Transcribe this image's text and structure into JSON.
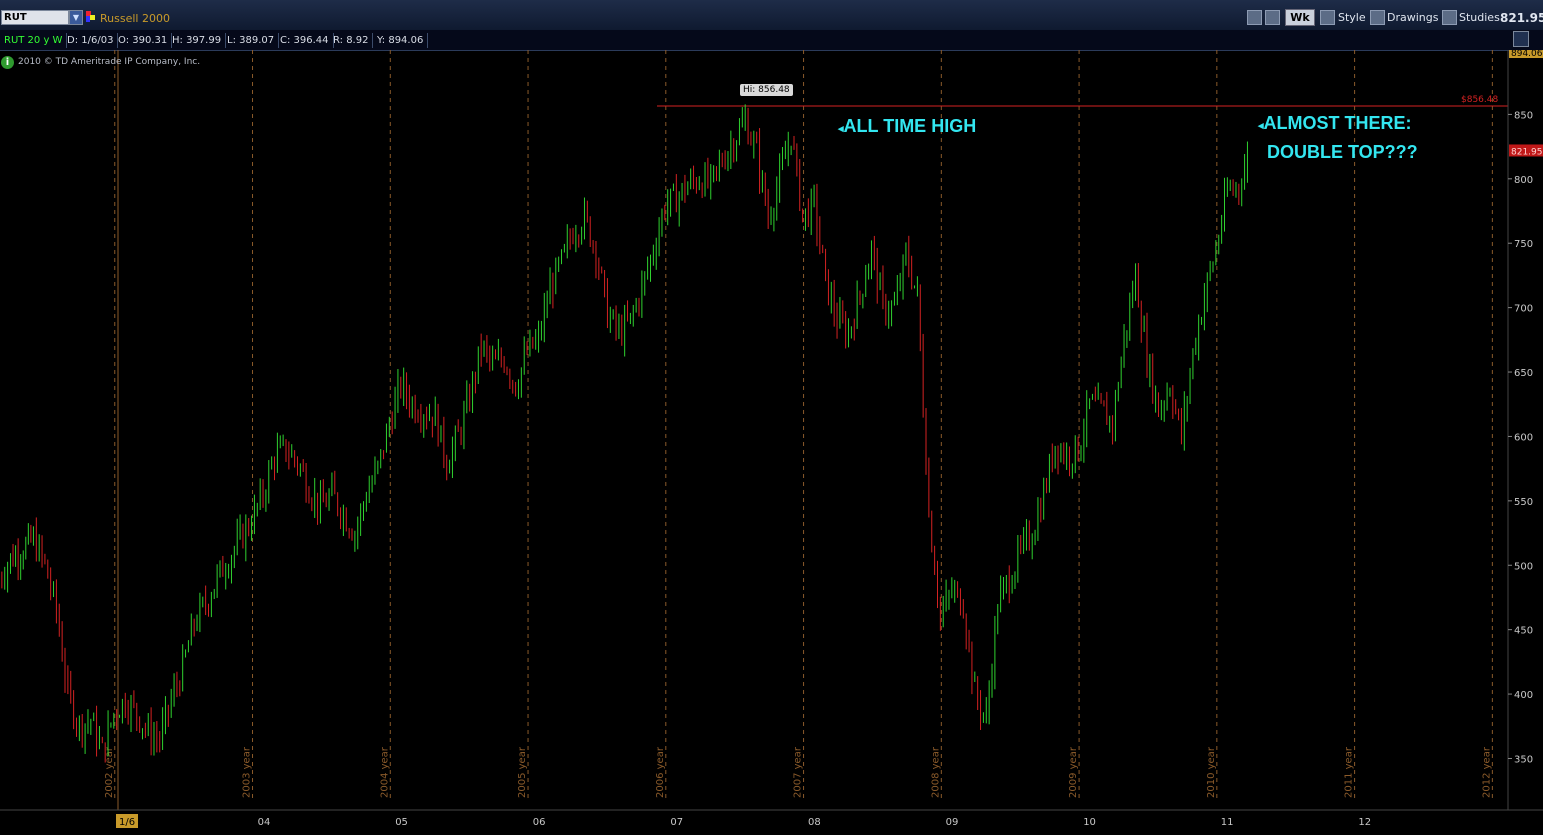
{
  "toolbar": {
    "symbol": "RUT",
    "symbol_name": "Russell 2000",
    "aggregation": "Wk",
    "style_label": "Style",
    "drawings_label": "Drawings",
    "studies_label": "Studies",
    "last_price": "821.95"
  },
  "infobar": {
    "study": "RUT 20 y W",
    "date": "D: 1/6/03",
    "open": "O: 390.31",
    "high": "H: 397.99",
    "low": "L: 389.07",
    "close": "C: 396.44",
    "range": "R: 8.92",
    "y": "Y: 894.06"
  },
  "copyright": "2010 © TD Ameritrade IP Company, Inc.",
  "annotations": {
    "all_time_high": "ALL TIME HIGH",
    "almost_line1": "ALMOST THERE:",
    "almost_line2": "DOUBLE TOP???"
  },
  "hi_label": "Hi: 856.48",
  "colors": {
    "up": "#2fd12f",
    "down": "#d42222",
    "annotation": "#33e6f0",
    "hi_line": "#d42222",
    "grid": "#8a5a2a"
  },
  "chart_data": {
    "type": "candlestick",
    "symbol": "RUT",
    "interval": "weekly",
    "ylim": [
      310,
      900
    ],
    "y_ticks": [
      350,
      400,
      450,
      500,
      550,
      600,
      650,
      700,
      750,
      800,
      850
    ],
    "y_axis_top_label": "894.06",
    "x_ticks": [
      "1/6",
      "04",
      "05",
      "06",
      "07",
      "08",
      "09",
      "10",
      "11",
      "12"
    ],
    "year_labels": [
      "2002 year",
      "2003 year",
      "2004 year",
      "2005 year",
      "2006 year",
      "2007 year",
      "2008 year",
      "2009 year",
      "2010 year",
      "2011 year",
      "2012 year"
    ],
    "hi_value": 856.48,
    "hi_tag": "$856.48",
    "last_tag": "821.95",
    "path": [
      [
        "2002-01",
        490
      ],
      [
        "2002-02",
        505
      ],
      [
        "2002-04",
        520
      ],
      [
        "2002-05",
        500
      ],
      [
        "2002-06",
        465
      ],
      [
        "2002-07",
        400
      ],
      [
        "2002-08",
        375
      ],
      [
        "2002-09",
        380
      ],
      [
        "2002-10",
        355
      ],
      [
        "2002-11",
        385
      ],
      [
        "2002-12",
        395
      ],
      [
        "2003-01",
        385
      ],
      [
        "2003-02",
        370
      ],
      [
        "2003-03",
        365
      ],
      [
        "2003-04",
        395
      ],
      [
        "2003-05",
        420
      ],
      [
        "2003-06",
        455
      ],
      [
        "2003-07",
        470
      ],
      [
        "2003-08",
        490
      ],
      [
        "2003-09",
        505
      ],
      [
        "2003-10",
        520
      ],
      [
        "2003-11",
        535
      ],
      [
        "2003-12",
        555
      ],
      [
        "2004-01",
        585
      ],
      [
        "2004-02",
        590
      ],
      [
        "2004-03",
        580
      ],
      [
        "2004-04",
        560
      ],
      [
        "2004-05",
        545
      ],
      [
        "2004-06",
        555
      ],
      [
        "2004-07",
        540
      ],
      [
        "2004-08",
        525
      ],
      [
        "2004-09",
        555
      ],
      [
        "2004-10",
        575
      ],
      [
        "2004-11",
        610
      ],
      [
        "2004-12",
        640
      ],
      [
        "2005-01",
        625
      ],
      [
        "2005-02",
        620
      ],
      [
        "2005-03",
        615
      ],
      [
        "2005-04",
        580
      ],
      [
        "2005-05",
        600
      ],
      [
        "2005-06",
        630
      ],
      [
        "2005-07",
        670
      ],
      [
        "2005-08",
        655
      ],
      [
        "2005-09",
        660
      ],
      [
        "2005-10",
        640
      ],
      [
        "2005-11",
        665
      ],
      [
        "2005-12",
        675
      ],
      [
        "2006-01",
        715
      ],
      [
        "2006-02",
        735
      ],
      [
        "2006-03",
        760
      ],
      [
        "2006-04",
        770
      ],
      [
        "2006-05",
        745
      ],
      [
        "2006-06",
        695
      ],
      [
        "2006-07",
        680
      ],
      [
        "2006-08",
        690
      ],
      [
        "2006-09",
        715
      ],
      [
        "2006-10",
        745
      ],
      [
        "2006-11",
        780
      ],
      [
        "2006-12",
        785
      ],
      [
        "2007-01",
        795
      ],
      [
        "2007-02",
        800
      ],
      [
        "2007-03",
        795
      ],
      [
        "2007-04",
        815
      ],
      [
        "2007-05",
        830
      ],
      [
        "2007-06",
        845
      ],
      [
        "2007-07",
        820
      ],
      [
        "2007-08",
        770
      ],
      [
        "2007-09",
        800
      ],
      [
        "2007-10",
        835
      ],
      [
        "2007-11",
        770
      ],
      [
        "2007-12",
        780
      ],
      [
        "2008-01",
        720
      ],
      [
        "2008-02",
        690
      ],
      [
        "2008-03",
        680
      ],
      [
        "2008-04",
        710
      ],
      [
        "2008-05",
        745
      ],
      [
        "2008-06",
        700
      ],
      [
        "2008-07",
        700
      ],
      [
        "2008-08",
        740
      ],
      [
        "2008-09",
        710
      ],
      [
        "2008-10",
        540
      ],
      [
        "2008-11",
        460
      ],
      [
        "2008-12",
        480
      ],
      [
        "2009-01",
        470
      ],
      [
        "2009-02",
        400
      ],
      [
        "2009-03",
        380
      ],
      [
        "2009-04",
        470
      ],
      [
        "2009-05",
        490
      ],
      [
        "2009-06",
        510
      ],
      [
        "2009-07",
        525
      ],
      [
        "2009-08",
        555
      ],
      [
        "2009-09",
        595
      ],
      [
        "2009-10",
        585
      ],
      [
        "2009-11",
        590
      ],
      [
        "2009-12",
        625
      ],
      [
        "2010-01",
        620
      ],
      [
        "2010-02",
        610
      ],
      [
        "2010-03",
        675
      ],
      [
        "2010-04",
        725
      ],
      [
        "2010-05",
        660
      ],
      [
        "2010-06",
        620
      ],
      [
        "2010-07",
        640
      ],
      [
        "2010-08",
        600
      ],
      [
        "2010-09",
        665
      ],
      [
        "2010-10",
        710
      ],
      [
        "2010-11",
        745
      ],
      [
        "2010-12",
        790
      ],
      [
        "2011-01",
        795
      ],
      [
        "2011-02",
        822
      ]
    ]
  }
}
